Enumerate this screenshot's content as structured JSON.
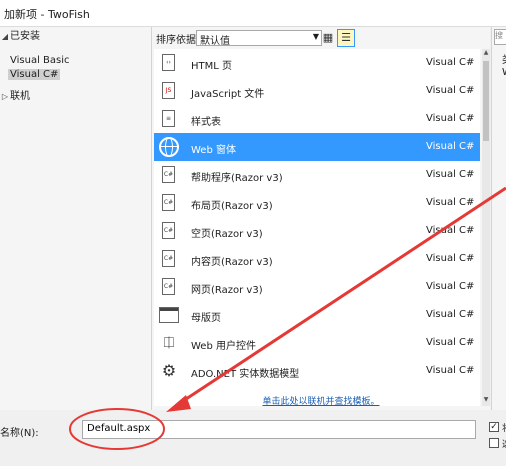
{
  "window": {
    "title": "加新项 - TwoFish"
  },
  "sidebar": {
    "installed": "已安装",
    "items": [
      "Visual Basic",
      "Visual C#"
    ],
    "online": "联机"
  },
  "toolbar": {
    "sort_label": "排序依据:",
    "sort_value": "默认值"
  },
  "templates": [
    {
      "name": "HTML 页",
      "lang": "Visual C#"
    },
    {
      "name": "JavaScript 文件",
      "lang": "Visual C#"
    },
    {
      "name": "样式表",
      "lang": "Visual C#"
    },
    {
      "name": "Web 窗体",
      "lang": "Visual C#"
    },
    {
      "name": "帮助程序(Razor v3)",
      "lang": "Visual C#"
    },
    {
      "name": "布局页(Razor v3)",
      "lang": "Visual C#"
    },
    {
      "name": "空页(Razor v3)",
      "lang": "Visual C#"
    },
    {
      "name": "内容页(Razor v3)",
      "lang": "Visual C#"
    },
    {
      "name": "网页(Razor v3)",
      "lang": "Visual C#"
    },
    {
      "name": "母版页",
      "lang": "Visual C#"
    },
    {
      "name": "Web 用户控件",
      "lang": "Visual C#"
    },
    {
      "name": "ADO.NET 实体数据模型",
      "lang": "Visual C#"
    }
  ],
  "online_link": "单击此处以联机并查找模板。",
  "right_panel": {
    "search_placeholder": "搜",
    "c1": "类",
    "c2": "W"
  },
  "bottom": {
    "name_label": "名称(N):",
    "name_value": "Default.aspx",
    "cb1": "将",
    "cb2": "选"
  },
  "colors": {
    "selection": "#3399ff",
    "annotation": "#e53935"
  }
}
